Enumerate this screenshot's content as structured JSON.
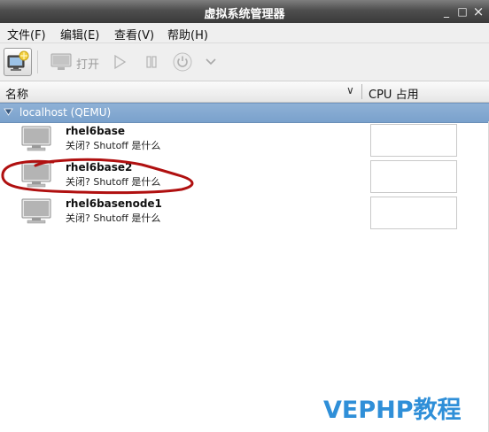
{
  "window": {
    "title": "虚拟系统管理器",
    "minimize_glyph": "_",
    "maximize_glyph": "□",
    "close_glyph": "×"
  },
  "menu": {
    "file": "文件(F)",
    "edit": "编辑(E)",
    "view": "查看(V)",
    "help": "帮助(H)"
  },
  "toolbar": {
    "open_label": "打开",
    "icons": [
      "new-vm-icon",
      "monitor-icon",
      "play-icon",
      "pause-icon",
      "power-icon",
      "chevron-down-icon"
    ]
  },
  "columns": {
    "name": "名称",
    "sort_arrow": "∨",
    "cpu": "CPU 占用"
  },
  "host": {
    "label": "localhost (QEMU)"
  },
  "vms": [
    {
      "name": "rhel6base",
      "status": "关闭? Shutoff 是什么"
    },
    {
      "name": "rhel6base2",
      "status": "关闭? Shutoff 是什么"
    },
    {
      "name": "rhel6basenode1",
      "status": "关闭? Shutoff 是什么"
    }
  ],
  "watermark": "VEPHP教程",
  "colors": {
    "host_row": "#7aa1cc",
    "annotation": "#b01010",
    "watermark": "#2f8fd8"
  }
}
